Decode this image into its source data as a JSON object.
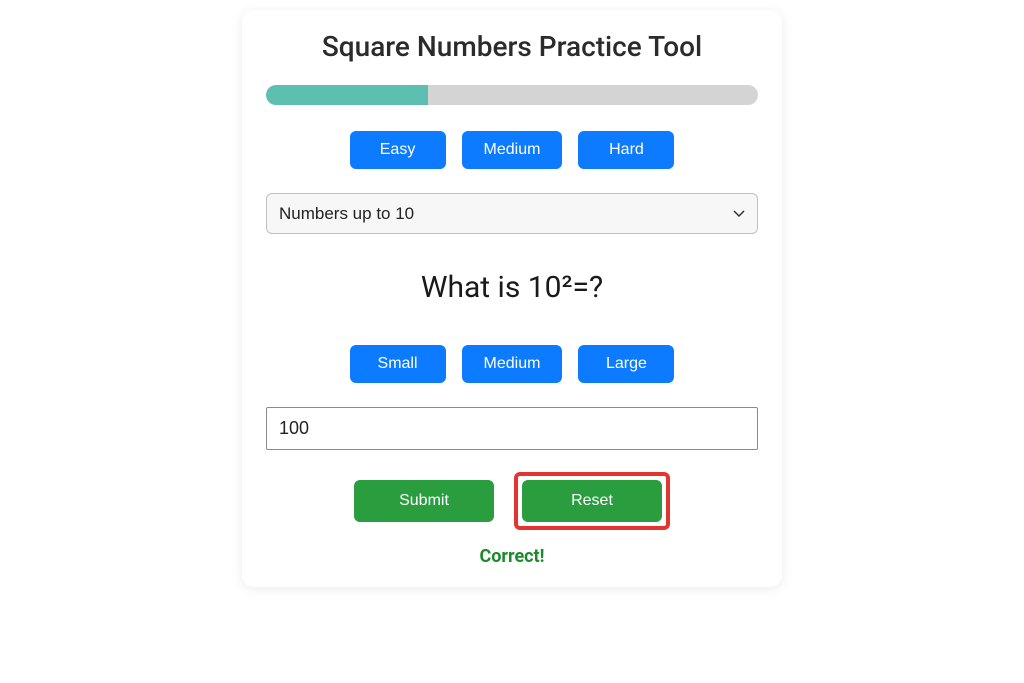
{
  "title": "Square Numbers Practice Tool",
  "progress": {
    "percent": 33
  },
  "difficulty": {
    "easy": "Easy",
    "medium": "Medium",
    "hard": "Hard"
  },
  "range_select": {
    "selected": "Numbers up to 10"
  },
  "question": "What is 10²=?",
  "size_buttons": {
    "small": "Small",
    "medium": "Medium",
    "large": "Large"
  },
  "answer": {
    "value": "100"
  },
  "actions": {
    "submit": "Submit",
    "reset": "Reset"
  },
  "feedback": "Correct!"
}
